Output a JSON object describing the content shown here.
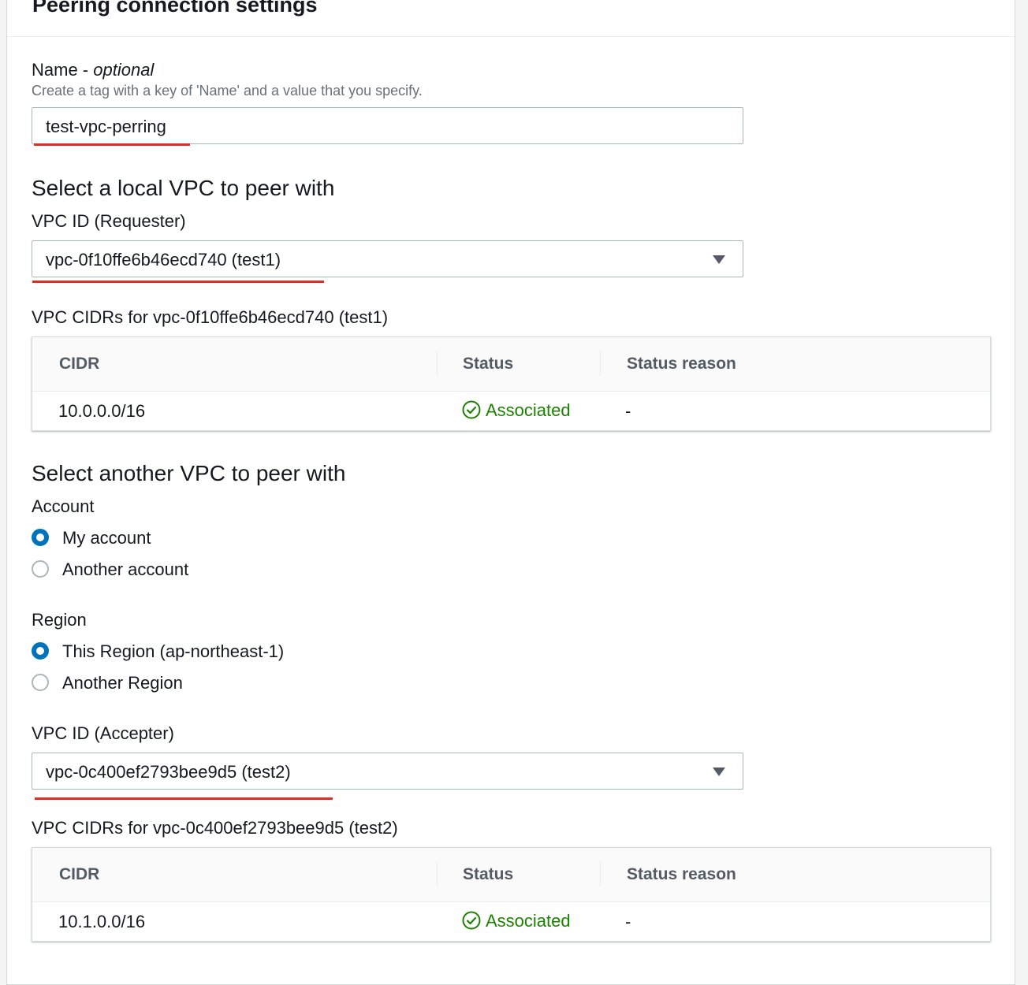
{
  "panel": {
    "title": "Peering connection settings"
  },
  "name_field": {
    "label": "Name - ",
    "label_optional": "optional",
    "hint": "Create a tag with a key of 'Name' and a value that you specify.",
    "value": "test-vpc-perring"
  },
  "local_vpc": {
    "heading": "Select a local VPC to peer with",
    "select_label": "VPC ID (Requester)",
    "selected": "vpc-0f10ffe6b46ecd740 (test1)",
    "cidr_title": "VPC CIDRs for vpc-0f10ffe6b46ecd740 (test1)",
    "table": {
      "headers": [
        "CIDR",
        "Status",
        "Status reason"
      ],
      "rows": [
        {
          "cidr": "10.0.0.0/16",
          "status": "Associated",
          "reason": "-"
        }
      ]
    }
  },
  "peer_vpc": {
    "heading": "Select another VPC to peer with",
    "account": {
      "label": "Account",
      "options": [
        "My account",
        "Another account"
      ],
      "selected": "My account"
    },
    "region": {
      "label": "Region",
      "options": [
        "This Region (ap-northeast-1)",
        "Another Region"
      ],
      "selected": "This Region (ap-northeast-1)"
    },
    "select_label": "VPC ID (Accepter)",
    "selected": "vpc-0c400ef2793bee9d5 (test2)",
    "cidr_title": "VPC CIDRs for vpc-0c400ef2793bee9d5 (test2)",
    "table": {
      "headers": [
        "CIDR",
        "Status",
        "Status reason"
      ],
      "rows": [
        {
          "cidr": "10.1.0.0/16",
          "status": "Associated",
          "reason": "-"
        }
      ]
    }
  },
  "colors": {
    "accent": "#0073bb",
    "success": "#1d8102",
    "annotation_underline": "#e02d24"
  },
  "icons": {
    "select_caret": "caret-down-icon",
    "status_ok": "check-circle-icon"
  }
}
